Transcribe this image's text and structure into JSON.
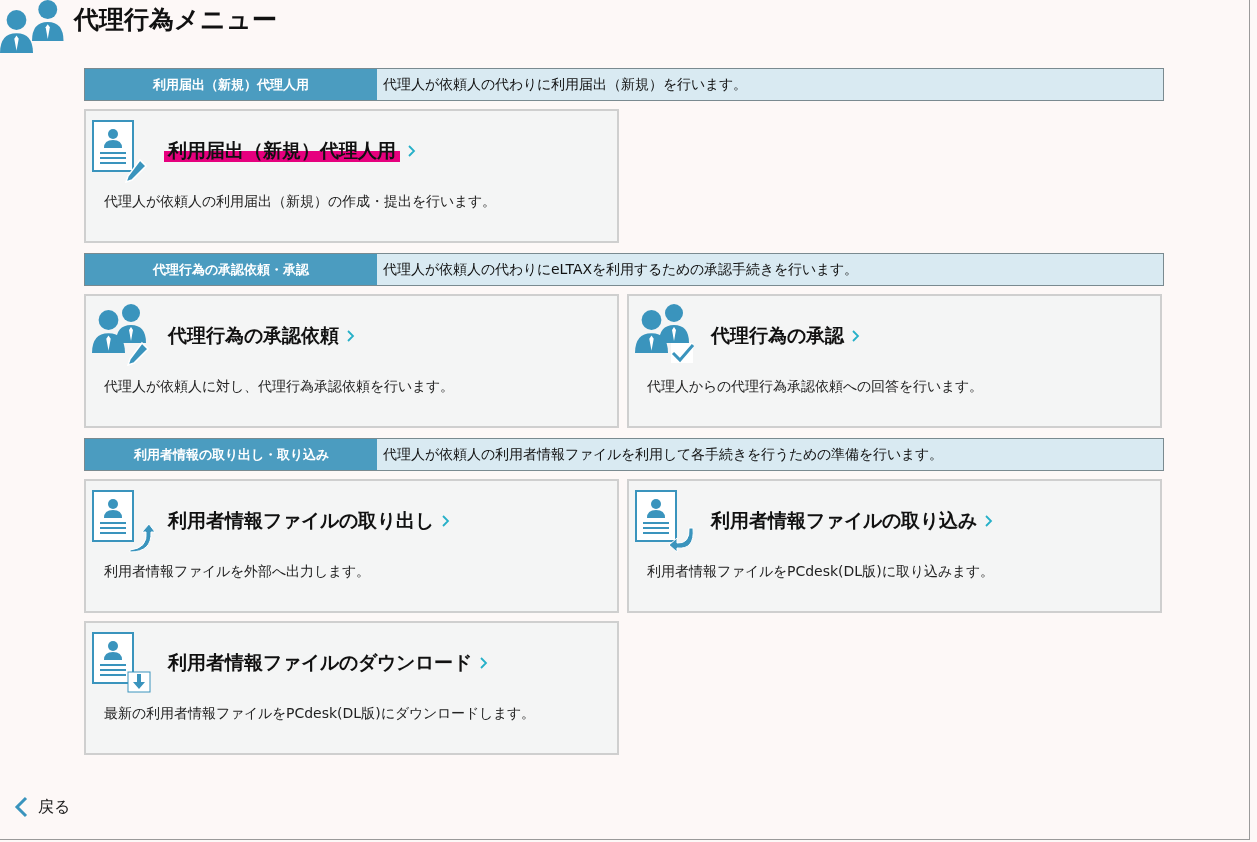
{
  "page": {
    "title": "代理行為メニュー"
  },
  "sections": [
    {
      "label": "利用届出（新規）代理人用",
      "description": "代理人が依頼人の代わりに利用届出（新規）を行います。",
      "items": [
        {
          "kind": "doc-pen",
          "title": "利用届出（新規）代理人用",
          "description": "代理人が依頼人の利用届出（新規）の作成・提出を行います。",
          "highlighted": true
        }
      ]
    },
    {
      "label": "代理行為の承認依頼・承認",
      "description": "代理人が依頼人の代わりにeLTAXを利用するための承認手続きを行います。",
      "items": [
        {
          "kind": "people-pen",
          "title": "代理行為の承認依頼",
          "description": "代理人が依頼人に対し、代理行為承認依頼を行います。",
          "highlighted": false
        },
        {
          "kind": "people-check",
          "title": "代理行為の承認",
          "description": "代理人からの代理行為承認依頼への回答を行います。",
          "highlighted": false
        }
      ]
    },
    {
      "label": "利用者情報の取り出し・取り込み",
      "description": "代理人が依頼人の利用者情報ファイルを利用して各手続きを行うための準備を行います。",
      "items": [
        {
          "kind": "doc-out",
          "title": "利用者情報ファイルの取り出し",
          "description": "利用者情報ファイルを外部へ出力します。",
          "highlighted": false
        },
        {
          "kind": "doc-in",
          "title": "利用者情報ファイルの取り込み",
          "description": "利用者情報ファイルをPCdesk(DL版)に取り込みます。",
          "highlighted": false
        },
        {
          "kind": "doc-download",
          "title": "利用者情報ファイルのダウンロード",
          "description": "最新の利用者情報ファイルをPCdesk(DL版)にダウンロードします。",
          "highlighted": false
        }
      ]
    }
  ],
  "back_link": {
    "label": "戻る"
  }
}
